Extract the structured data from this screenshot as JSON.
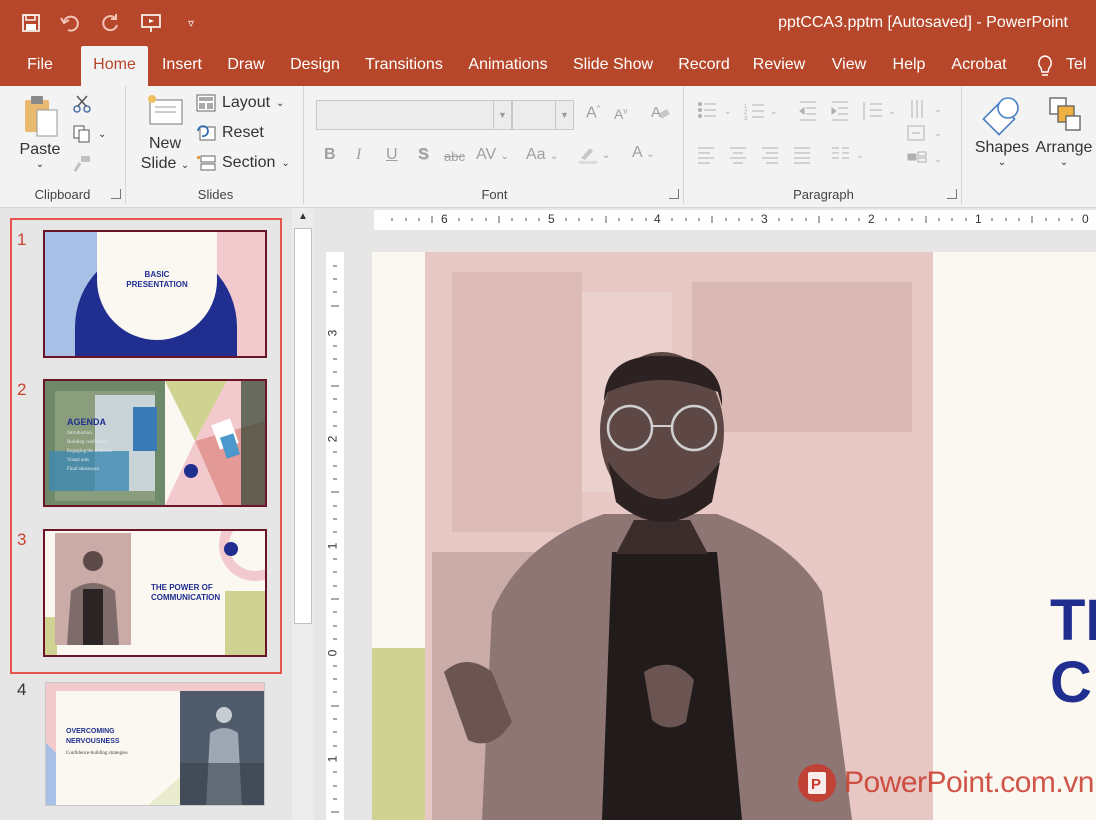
{
  "window": {
    "title": "pptCCA3.pptm [Autosaved]  -  PowerPoint",
    "qat": [
      "save-icon",
      "undo-icon",
      "redo-icon",
      "present-icon",
      "customize-icon"
    ],
    "accent": "#b7472a"
  },
  "tabs": [
    "File",
    "Home",
    "Insert",
    "Draw",
    "Design",
    "Transitions",
    "Animations",
    "Slide Show",
    "Record",
    "Review",
    "View",
    "Help",
    "Acrobat",
    "Tel"
  ],
  "active_tab": "Home",
  "ribbon": {
    "clipboard": {
      "label": "Clipboard",
      "paste": "Paste"
    },
    "slides": {
      "label": "Slides",
      "new_slide_1": "New",
      "new_slide_2": "Slide",
      "layout": "Layout",
      "reset": "Reset",
      "section": "Section"
    },
    "font": {
      "label": "Font",
      "bold": "B",
      "italic": "I",
      "underline": "U",
      "shadow": "S",
      "strike": "abc",
      "spacing": "AV",
      "case": "Aa",
      "font_color": "A",
      "grow": "A",
      "shrink": "A"
    },
    "paragraph": {
      "label": "Paragraph"
    },
    "drawing": {
      "shapes": "Shapes",
      "arrange": "Arrange"
    }
  },
  "thumbnails": [
    {
      "num": "1",
      "title_line1": "BASIC",
      "title_line2": "PRESENTATION"
    },
    {
      "num": "2",
      "title": "AGENDA",
      "bullets": [
        "Introduction",
        "Building confidence",
        "Engaging the audience",
        "Visual aids",
        "Final takeaways"
      ]
    },
    {
      "num": "3",
      "title_line1": "THE POWER OF",
      "title_line2": "COMMUNICATION"
    },
    {
      "num": "4",
      "title_line1": "OVERCOMING",
      "title_line2": "NERVOUSNESS",
      "subtitle": "Confidence-building strategies"
    }
  ],
  "ruler": {
    "horizontal": [
      "6",
      "5",
      "4",
      "3",
      "2",
      "1",
      "0"
    ],
    "vertical": [
      "3",
      "2",
      "1",
      "0",
      "1"
    ]
  },
  "slide": {
    "title_fragment_1": "TI",
    "title_fragment_2": "C"
  },
  "watermark": {
    "text": "PowerPoint.com.vn",
    "color": "#c9382a"
  },
  "colors": {
    "navy": "#1f2e8f",
    "pink": "#f2c9cc",
    "sage": "#d0d291",
    "cream": "#fbf8f2",
    "selection": "#e8554e"
  }
}
